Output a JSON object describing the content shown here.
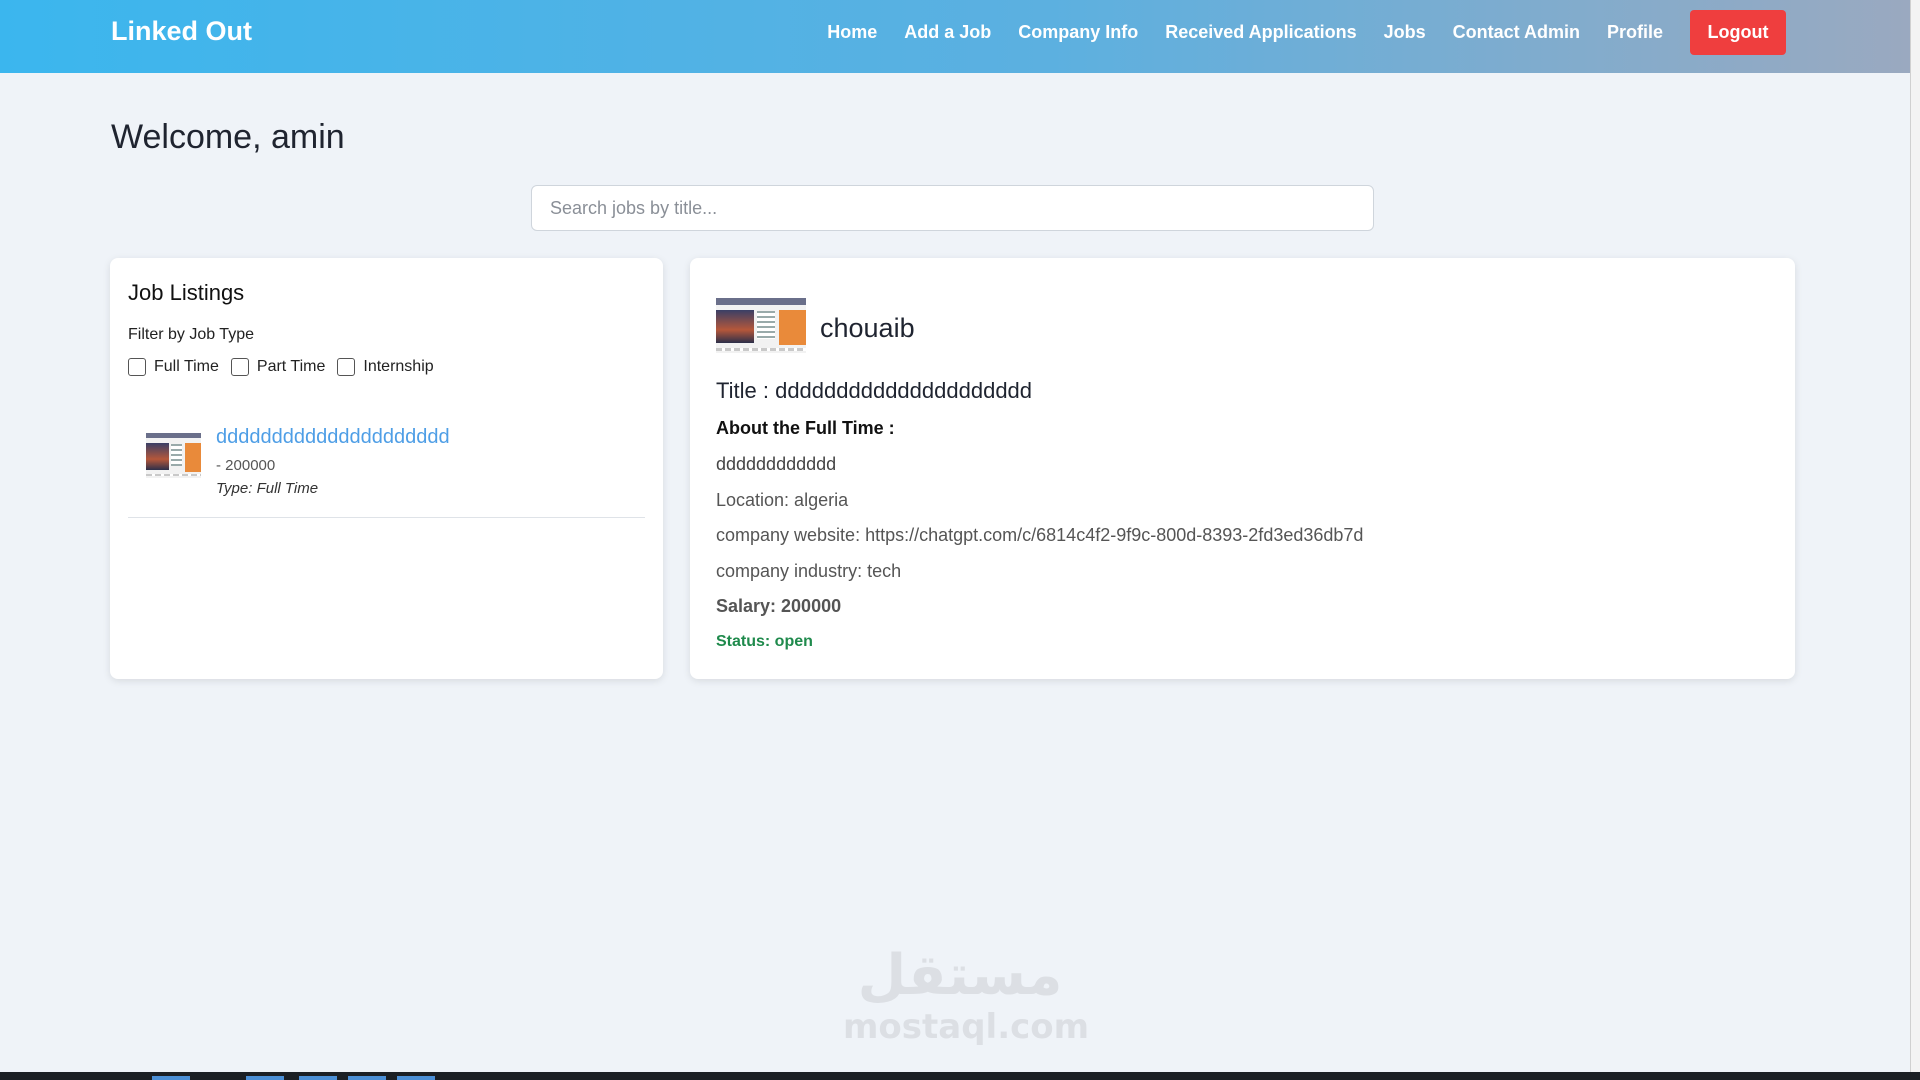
{
  "navbar": {
    "brand": "Linked Out",
    "links": [
      "Home",
      "Add a Job",
      "Company Info",
      "Received Applications",
      "Jobs",
      "Contact Admin",
      "Profile"
    ],
    "logout_label": "Logout",
    "gradient_colors": [
      "#3bb6ee",
      "#9aa9c0"
    ]
  },
  "welcome": "Welcome, amin",
  "search": {
    "placeholder": "Search jobs by title..."
  },
  "listings": {
    "title": "Job Listings",
    "filter_label": "Filter by Job Type",
    "filters": [
      {
        "label": "Full Time",
        "checked": false
      },
      {
        "label": "Part Time",
        "checked": false
      },
      {
        "label": "Internship",
        "checked": false
      }
    ],
    "jobs": [
      {
        "title": "ddddddddddddddddddddd",
        "salary": "- 200000",
        "type": "Type: Full Time",
        "thumbnail": "job-thumbnail"
      }
    ]
  },
  "detail": {
    "company_name": "chouaib",
    "title": "Title : ddddddddddddddddddddd",
    "about_label": "About the Full Time :",
    "description": "dddddddddddd",
    "location": "Location: algeria",
    "website": "company website: https://chatgpt.com/c/6814c4f2-9f9c-800d-8393-2fd3ed36db7d",
    "industry": "company industry: tech",
    "salary": "Salary: 200000",
    "status": "Status: open",
    "status_color": "#1f8a4c"
  },
  "watermark": {
    "arabic": "مستقل",
    "latin": "mostaql.com"
  },
  "colors": {
    "accent_link": "#4e9ee6",
    "logout": "#ef3e3e",
    "background": "#eff3f8"
  }
}
